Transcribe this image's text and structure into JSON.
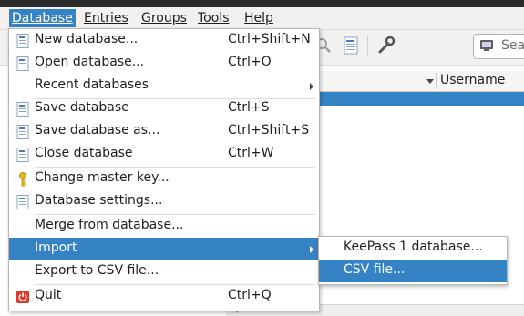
{
  "menubar": {
    "items": [
      {
        "label": "Database"
      },
      {
        "label": "Entries"
      },
      {
        "label": "Groups"
      },
      {
        "label": "Tools"
      },
      {
        "label": "Help"
      }
    ]
  },
  "search": {
    "placeholder": "Sea"
  },
  "table": {
    "columns": [
      "Username"
    ]
  },
  "database_menu": {
    "items": [
      {
        "label": "New database...",
        "shortcut": "Ctrl+Shift+N",
        "icon": "document-icon"
      },
      {
        "label": "Open database...",
        "shortcut": "Ctrl+O",
        "icon": "document-icon"
      },
      {
        "label": "Recent databases",
        "shortcut": "",
        "icon": ""
      },
      {
        "label": "Save database",
        "shortcut": "Ctrl+S",
        "icon": "document-icon"
      },
      {
        "label": "Save database as...",
        "shortcut": "Ctrl+Shift+S",
        "icon": "document-icon"
      },
      {
        "label": "Close database",
        "shortcut": "Ctrl+W",
        "icon": "document-icon"
      },
      {
        "label": "Change master key...",
        "shortcut": "",
        "icon": "key-icon"
      },
      {
        "label": "Database settings...",
        "shortcut": "",
        "icon": "document-icon"
      },
      {
        "label": "Merge from database...",
        "shortcut": "",
        "icon": ""
      },
      {
        "label": "Import",
        "shortcut": "",
        "icon": ""
      },
      {
        "label": "Export to CSV file...",
        "shortcut": "",
        "icon": ""
      },
      {
        "label": "Quit",
        "shortcut": "Ctrl+Q",
        "icon": "power-icon"
      }
    ]
  },
  "import_submenu": {
    "items": [
      {
        "label": "KeePass 1 database..."
      },
      {
        "label": "CSV file..."
      }
    ]
  },
  "colors": {
    "highlight": "#3582c4",
    "menubar_bg": "#f2f1f0",
    "quit_icon": "#d93a2b"
  }
}
